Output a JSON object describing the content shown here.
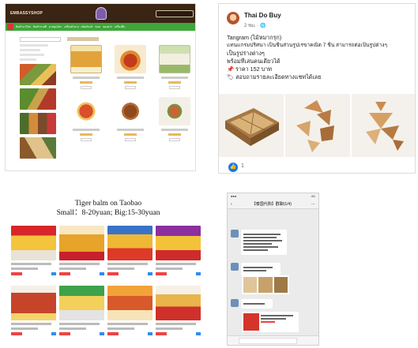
{
  "shop": {
    "nav_items": [
      "สินค้ามาใหม่",
      "สินค้าขายดี",
      "ยาสมุนไพร",
      "เครื่องสำอาง",
      "ผลิตภัณฑ์",
      "ขนม",
      "ของฝาก",
      "เครื่องดื่ม",
      "อื่นๆ"
    ],
    "products_row1": [
      "herbal-box-product",
      "spicy-sauce-jar-product",
      "herbal-package-product"
    ],
    "products_row2": [
      "tom-yum-soup-dish",
      "curry-bowl-dish",
      "noodle-soup-dish"
    ]
  },
  "facebook": {
    "page_name": "Thai Do Buy",
    "time": "2 ชม. · 🌐",
    "lines": [
      "Tangram (ไม้หมากรุก)",
      "แทนแกรมปริศนา เป็นชิ้นส่วนรูปเรขาคณิต 7 ชิ้น สามารถต่อเป็นรูปต่างๆ",
      "เป็นรูปร่างต่างๆ",
      "พร้อมที่เล่นคนเดียวได้",
      "📌 ราคา 152 บาท",
      "🏷 สอบถามรายละเอียดทางแชทได้เลย"
    ],
    "reaction_count": "1"
  },
  "taobao": {
    "caption_line1": "Tiger balm on Taobao",
    "caption_line2": "Small：8-20yuan; Big:15-30yuan"
  },
  "wechat": {
    "chat_title": "【泰国代购】群聊(1/4)",
    "messages": 5
  }
}
